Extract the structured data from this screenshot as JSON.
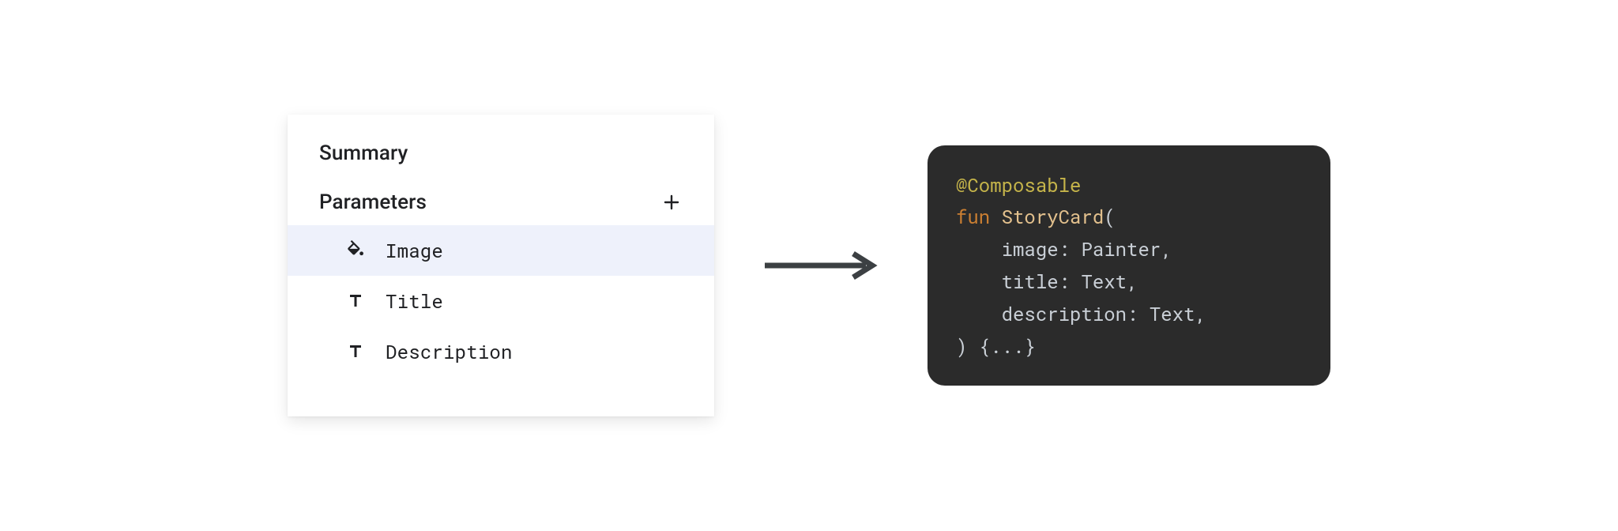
{
  "panel": {
    "summaryTitle": "Summary",
    "parametersTitle": "Parameters",
    "params": {
      "image": {
        "label": "Image",
        "iconName": "fill-icon"
      },
      "title": {
        "label": "Title",
        "iconName": "text-type-icon"
      },
      "description": {
        "label": "Description",
        "iconName": "text-type-icon"
      }
    }
  },
  "code": {
    "annotation": "@Composable",
    "keyword": "fun",
    "fnName": "StoryCard",
    "openParen": "(",
    "params": [
      {
        "name": "image",
        "type": "Painter"
      },
      {
        "name": "title",
        "type": "Text"
      },
      {
        "name": "description",
        "type": "Text"
      }
    ],
    "closeParenBrace": ") {...}",
    "indent": "    "
  },
  "colors": {
    "codeBg": "#2b2b2b",
    "codeAnnotation": "#c5b44a",
    "codeKeyword": "#cb7f32",
    "codeFnName": "#e2c08d",
    "codeDefault": "#c9cfd6",
    "panelShadow": "rgba(0,0,0,0.10)",
    "selectedRowBg": "#eef1fb"
  }
}
